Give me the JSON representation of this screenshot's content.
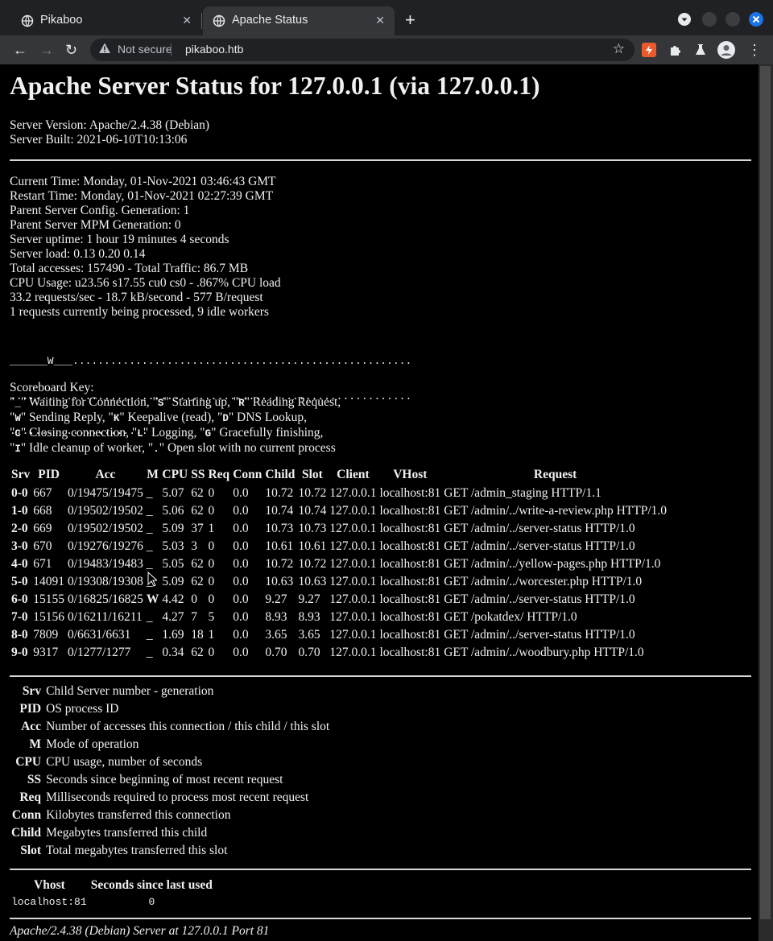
{
  "browser": {
    "tabs": [
      {
        "title": "Pikaboo",
        "active": false
      },
      {
        "title": "Apache Status",
        "active": true
      }
    ],
    "address": {
      "security_label": "Not secure",
      "url": "pikaboo.htb"
    },
    "accent_close": "#1a73e8"
  },
  "page": {
    "heading": "Apache Server Status for 127.0.0.1 (via 127.0.0.1)",
    "server_info": [
      "Server Version: Apache/2.4.38 (Debian)",
      "Server Built: 2021-06-10T10:13:06"
    ],
    "stats": [
      "Current Time: Monday, 01-Nov-2021 03:46:43 GMT",
      "Restart Time: Monday, 01-Nov-2021 02:27:39 GMT",
      "Parent Server Config. Generation: 1",
      "Parent Server MPM Generation: 0",
      "Server uptime: 1 hour 19 minutes 4 seconds",
      "Server load: 0.13 0.20 0.14",
      "Total accesses: 157490 - Total Traffic: 86.7 MB",
      "CPU Usage: u23.56 s17.55 cu0 cs0 - .867% CPU load",
      "33.2 requests/sec - 18.7 kB/second - 577 B/request",
      "1 requests currently being processed, 9 idle workers"
    ],
    "scoreboard": [
      "______W___......................................................",
      "................................................................",
      "......................"
    ],
    "scoreboard_key_title": "Scoreboard Key:",
    "scoreboard_key": [
      [
        [
          "\"",
          false
        ],
        [
          "_",
          true
        ],
        [
          "\" Waiting for Connection, \"",
          false
        ],
        [
          "S",
          true
        ],
        [
          "\" Starting up, \"",
          false
        ],
        [
          "R",
          true
        ],
        [
          "\" Reading Request,",
          false
        ]
      ],
      [
        [
          "\"",
          false
        ],
        [
          "W",
          true
        ],
        [
          "\" Sending Reply, \"",
          false
        ],
        [
          "K",
          true
        ],
        [
          "\" Keepalive (read), \"",
          false
        ],
        [
          "D",
          true
        ],
        [
          "\" DNS Lookup,",
          false
        ]
      ],
      [
        [
          "\"",
          false
        ],
        [
          "C",
          true
        ],
        [
          "\" Closing connection, \"",
          false
        ],
        [
          "L",
          true
        ],
        [
          "\" Logging, \"",
          false
        ],
        [
          "G",
          true
        ],
        [
          "\" Gracefully finishing,",
          false
        ]
      ],
      [
        [
          "\"",
          false
        ],
        [
          "I",
          true
        ],
        [
          "\" Idle cleanup of worker, \"",
          false
        ],
        [
          ".",
          true
        ],
        [
          "\" Open slot with no current process",
          false
        ]
      ]
    ],
    "workers": {
      "headers": [
        "Srv",
        "PID",
        "Acc",
        "M",
        "CPU",
        "SS",
        "Req",
        "Conn",
        "Child",
        "Slot",
        "Client",
        "VHost",
        "Request"
      ],
      "rows": [
        [
          "0-0",
          "667",
          "0/19475/19475",
          "_",
          "5.07",
          "62",
          "0",
          "0.0",
          "10.72",
          "10.72",
          "127.0.0.1",
          "localhost:81",
          "GET /admin_staging HTTP/1.1"
        ],
        [
          "1-0",
          "668",
          "0/19502/19502",
          "_",
          "5.06",
          "62",
          "0",
          "0.0",
          "10.74",
          "10.74",
          "127.0.0.1",
          "localhost:81",
          "GET /admin/../write-a-review.php HTTP/1.0"
        ],
        [
          "2-0",
          "669",
          "0/19502/19502",
          "_",
          "5.09",
          "37",
          "1",
          "0.0",
          "10.73",
          "10.73",
          "127.0.0.1",
          "localhost:81",
          "GET /admin/../server-status HTTP/1.0"
        ],
        [
          "3-0",
          "670",
          "0/19276/19276",
          "_",
          "5.03",
          "3",
          "0",
          "0.0",
          "10.61",
          "10.61",
          "127.0.0.1",
          "localhost:81",
          "GET /admin/../server-status HTTP/1.0"
        ],
        [
          "4-0",
          "671",
          "0/19483/19483",
          "_",
          "5.05",
          "62",
          "0",
          "0.0",
          "10.72",
          "10.72",
          "127.0.0.1",
          "localhost:81",
          "GET /admin/../yellow-pages.php HTTP/1.0"
        ],
        [
          "5-0",
          "14091",
          "0/19308/19308",
          "_",
          "5.09",
          "62",
          "0",
          "0.0",
          "10.63",
          "10.63",
          "127.0.0.1",
          "localhost:81",
          "GET /admin/../worcester.php HTTP/1.0"
        ],
        [
          "6-0",
          "15155",
          "0/16825/16825",
          "W",
          "4.42",
          "0",
          "0",
          "0.0",
          "9.27",
          "9.27",
          "127.0.0.1",
          "localhost:81",
          "GET /admin/../server-status HTTP/1.0"
        ],
        [
          "7-0",
          "15156",
          "0/16211/16211",
          "_",
          "4.27",
          "7",
          "5",
          "0.0",
          "8.93",
          "8.93",
          "127.0.0.1",
          "localhost:81",
          "GET /pokatdex/ HTTP/1.0"
        ],
        [
          "8-0",
          "7809",
          "0/6631/6631",
          "_",
          "1.69",
          "18",
          "1",
          "0.0",
          "3.65",
          "3.65",
          "127.0.0.1",
          "localhost:81",
          "GET /admin/../server-status HTTP/1.0"
        ],
        [
          "9-0",
          "9317",
          "0/1277/1277",
          "_",
          "0.34",
          "62",
          "0",
          "0.0",
          "0.70",
          "0.70",
          "127.0.0.1",
          "localhost:81",
          "GET /admin/../woodbury.php HTTP/1.0"
        ]
      ]
    },
    "legend": [
      [
        "Srv",
        "Child Server number - generation"
      ],
      [
        "PID",
        "OS process ID"
      ],
      [
        "Acc",
        "Number of accesses this connection / this child / this slot"
      ],
      [
        "M",
        "Mode of operation"
      ],
      [
        "CPU",
        "CPU usage, number of seconds"
      ],
      [
        "SS",
        "Seconds since beginning of most recent request"
      ],
      [
        "Req",
        "Milliseconds required to process most recent request"
      ],
      [
        "Conn",
        "Kilobytes transferred this connection"
      ],
      [
        "Child",
        "Megabytes transferred this child"
      ],
      [
        "Slot",
        "Total megabytes transferred this slot"
      ]
    ],
    "vhosts": {
      "headers": [
        "Vhost",
        "Seconds since last used"
      ],
      "rows": [
        [
          "localhost:81",
          "0"
        ]
      ]
    },
    "footer": "Apache/2.4.38 (Debian) Server at 127.0.0.1 Port 81"
  }
}
